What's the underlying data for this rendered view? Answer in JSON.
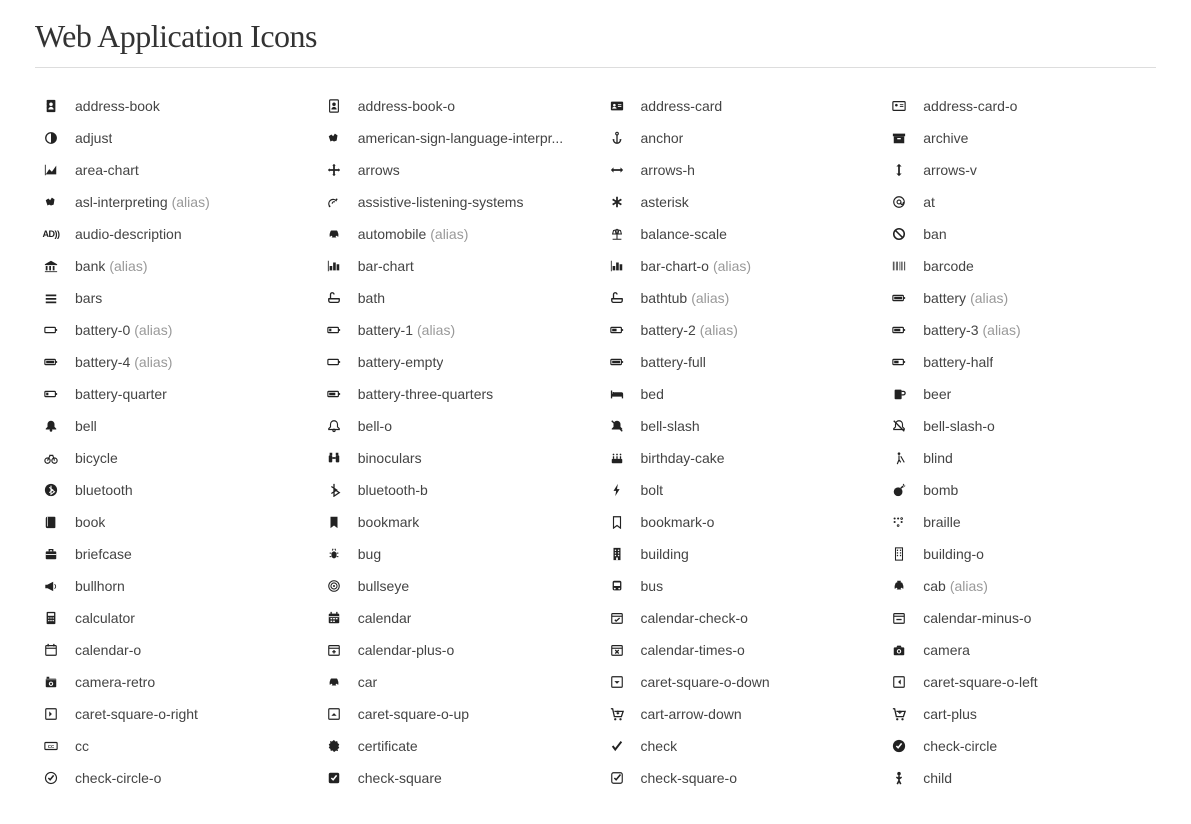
{
  "title": "Web Application Icons",
  "alias_suffix": "(alias)",
  "icons": [
    {
      "name": "address-book",
      "glyph": "address-book",
      "alias": false
    },
    {
      "name": "address-book-o",
      "glyph": "address-book-o",
      "alias": false
    },
    {
      "name": "address-card",
      "glyph": "address-card",
      "alias": false
    },
    {
      "name": "address-card-o",
      "glyph": "address-card-o",
      "alias": false
    },
    {
      "name": "adjust",
      "glyph": "adjust",
      "alias": false
    },
    {
      "name": "american-sign-language-interpr...",
      "glyph": "asl",
      "alias": false
    },
    {
      "name": "anchor",
      "glyph": "anchor",
      "alias": false
    },
    {
      "name": "archive",
      "glyph": "archive",
      "alias": false
    },
    {
      "name": "area-chart",
      "glyph": "area-chart",
      "alias": false
    },
    {
      "name": "arrows",
      "glyph": "arrows",
      "alias": false
    },
    {
      "name": "arrows-h",
      "glyph": "arrows-h",
      "alias": false
    },
    {
      "name": "arrows-v",
      "glyph": "arrows-v",
      "alias": false
    },
    {
      "name": "asl-interpreting",
      "glyph": "asl",
      "alias": true
    },
    {
      "name": "assistive-listening-systems",
      "glyph": "als",
      "alias": false
    },
    {
      "name": "asterisk",
      "glyph": "asterisk",
      "alias": false
    },
    {
      "name": "at",
      "glyph": "at",
      "alias": false
    },
    {
      "name": "audio-description",
      "glyph": "ad",
      "alias": false
    },
    {
      "name": "automobile",
      "glyph": "car",
      "alias": true
    },
    {
      "name": "balance-scale",
      "glyph": "balance",
      "alias": false
    },
    {
      "name": "ban",
      "glyph": "ban",
      "alias": false
    },
    {
      "name": "bank",
      "glyph": "bank",
      "alias": true
    },
    {
      "name": "bar-chart",
      "glyph": "bar-chart",
      "alias": false
    },
    {
      "name": "bar-chart-o",
      "glyph": "bar-chart",
      "alias": true
    },
    {
      "name": "barcode",
      "glyph": "barcode",
      "alias": false
    },
    {
      "name": "bars",
      "glyph": "bars",
      "alias": false
    },
    {
      "name": "bath",
      "glyph": "bath",
      "alias": false
    },
    {
      "name": "bathtub",
      "glyph": "bath",
      "alias": true
    },
    {
      "name": "battery",
      "glyph": "battery-full",
      "alias": true
    },
    {
      "name": "battery-0",
      "glyph": "battery-empty",
      "alias": true
    },
    {
      "name": "battery-1",
      "glyph": "battery-quarter",
      "alias": true
    },
    {
      "name": "battery-2",
      "glyph": "battery-half",
      "alias": true
    },
    {
      "name": "battery-3",
      "glyph": "battery-three",
      "alias": true
    },
    {
      "name": "battery-4",
      "glyph": "battery-full",
      "alias": true
    },
    {
      "name": "battery-empty",
      "glyph": "battery-empty",
      "alias": false
    },
    {
      "name": "battery-full",
      "glyph": "battery-full",
      "alias": false
    },
    {
      "name": "battery-half",
      "glyph": "battery-half",
      "alias": false
    },
    {
      "name": "battery-quarter",
      "glyph": "battery-quarter",
      "alias": false
    },
    {
      "name": "battery-three-quarters",
      "glyph": "battery-three",
      "alias": false
    },
    {
      "name": "bed",
      "glyph": "bed",
      "alias": false
    },
    {
      "name": "beer",
      "glyph": "beer",
      "alias": false
    },
    {
      "name": "bell",
      "glyph": "bell",
      "alias": false
    },
    {
      "name": "bell-o",
      "glyph": "bell-o",
      "alias": false
    },
    {
      "name": "bell-slash",
      "glyph": "bell-slash",
      "alias": false
    },
    {
      "name": "bell-slash-o",
      "glyph": "bell-slash-o",
      "alias": false
    },
    {
      "name": "bicycle",
      "glyph": "bicycle",
      "alias": false
    },
    {
      "name": "binoculars",
      "glyph": "binoculars",
      "alias": false
    },
    {
      "name": "birthday-cake",
      "glyph": "cake",
      "alias": false
    },
    {
      "name": "blind",
      "glyph": "blind",
      "alias": false
    },
    {
      "name": "bluetooth",
      "glyph": "bluetooth",
      "alias": false
    },
    {
      "name": "bluetooth-b",
      "glyph": "bluetooth-b",
      "alias": false
    },
    {
      "name": "bolt",
      "glyph": "bolt",
      "alias": false
    },
    {
      "name": "bomb",
      "glyph": "bomb",
      "alias": false
    },
    {
      "name": "book",
      "glyph": "book",
      "alias": false
    },
    {
      "name": "bookmark",
      "glyph": "bookmark",
      "alias": false
    },
    {
      "name": "bookmark-o",
      "glyph": "bookmark-o",
      "alias": false
    },
    {
      "name": "braille",
      "glyph": "braille",
      "alias": false
    },
    {
      "name": "briefcase",
      "glyph": "briefcase",
      "alias": false
    },
    {
      "name": "bug",
      "glyph": "bug",
      "alias": false
    },
    {
      "name": "building",
      "glyph": "building",
      "alias": false
    },
    {
      "name": "building-o",
      "glyph": "building-o",
      "alias": false
    },
    {
      "name": "bullhorn",
      "glyph": "bullhorn",
      "alias": false
    },
    {
      "name": "bullseye",
      "glyph": "bullseye",
      "alias": false
    },
    {
      "name": "bus",
      "glyph": "bus",
      "alias": false
    },
    {
      "name": "cab",
      "glyph": "taxi",
      "alias": true
    },
    {
      "name": "calculator",
      "glyph": "calculator",
      "alias": false
    },
    {
      "name": "calendar",
      "glyph": "calendar",
      "alias": false
    },
    {
      "name": "calendar-check-o",
      "glyph": "cal-check",
      "alias": false
    },
    {
      "name": "calendar-minus-o",
      "glyph": "cal-minus",
      "alias": false
    },
    {
      "name": "calendar-o",
      "glyph": "cal-o",
      "alias": false
    },
    {
      "name": "calendar-plus-o",
      "glyph": "cal-plus",
      "alias": false
    },
    {
      "name": "calendar-times-o",
      "glyph": "cal-times",
      "alias": false
    },
    {
      "name": "camera",
      "glyph": "camera",
      "alias": false
    },
    {
      "name": "camera-retro",
      "glyph": "camera-retro",
      "alias": false
    },
    {
      "name": "car",
      "glyph": "car",
      "alias": false
    },
    {
      "name": "caret-square-o-down",
      "glyph": "csq-down",
      "alias": false
    },
    {
      "name": "caret-square-o-left",
      "glyph": "csq-left",
      "alias": false
    },
    {
      "name": "caret-square-o-right",
      "glyph": "csq-right",
      "alias": false
    },
    {
      "name": "caret-square-o-up",
      "glyph": "csq-up",
      "alias": false
    },
    {
      "name": "cart-arrow-down",
      "glyph": "cart-down",
      "alias": false
    },
    {
      "name": "cart-plus",
      "glyph": "cart-plus",
      "alias": false
    },
    {
      "name": "cc",
      "glyph": "cc",
      "alias": false
    },
    {
      "name": "certificate",
      "glyph": "certificate",
      "alias": false
    },
    {
      "name": "check",
      "glyph": "check",
      "alias": false
    },
    {
      "name": "check-circle",
      "glyph": "check-circle",
      "alias": false
    },
    {
      "name": "check-circle-o",
      "glyph": "check-circle-o",
      "alias": false
    },
    {
      "name": "check-square",
      "glyph": "check-square",
      "alias": false
    },
    {
      "name": "check-square-o",
      "glyph": "check-square-o",
      "alias": false
    },
    {
      "name": "child",
      "glyph": "child",
      "alias": false
    }
  ]
}
